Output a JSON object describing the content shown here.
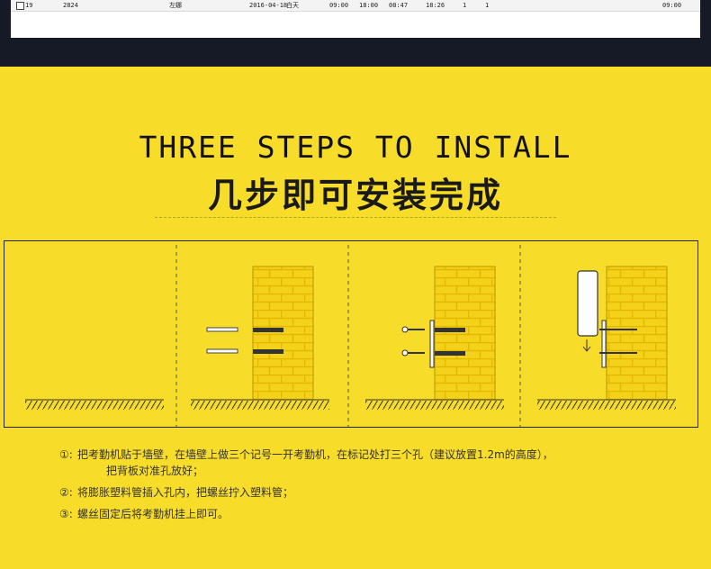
{
  "sheet_row": {
    "cells": [
      "19",
      "2824",
      "左娜",
      "2016-04-18",
      "白天",
      "09:00",
      "18:00",
      "08:47",
      "18:26",
      "1",
      "1",
      "09:00"
    ]
  },
  "install": {
    "title_en": "THREE STEPS TO INSTALL",
    "title_zh": "几步即可安装完成",
    "steps": [
      {
        "num": "①:",
        "text": "把考勤机贴于墙壁，在墙壁上做三个记号一开考勤机，在标记处打三个孔（建议放置1.2m的高度），",
        "cont": "把背板对准孔放好；"
      },
      {
        "num": "②:",
        "text": "将膨胀塑料管插入孔内，把螺丝拧入塑料管；"
      },
      {
        "num": "③:",
        "text": "螺丝固定后将考勤机挂上即可。"
      }
    ],
    "colors": {
      "background": "#f7dc2a",
      "brick": "#f4d11b",
      "mortar": "#e8c000",
      "line": "#333333"
    }
  }
}
